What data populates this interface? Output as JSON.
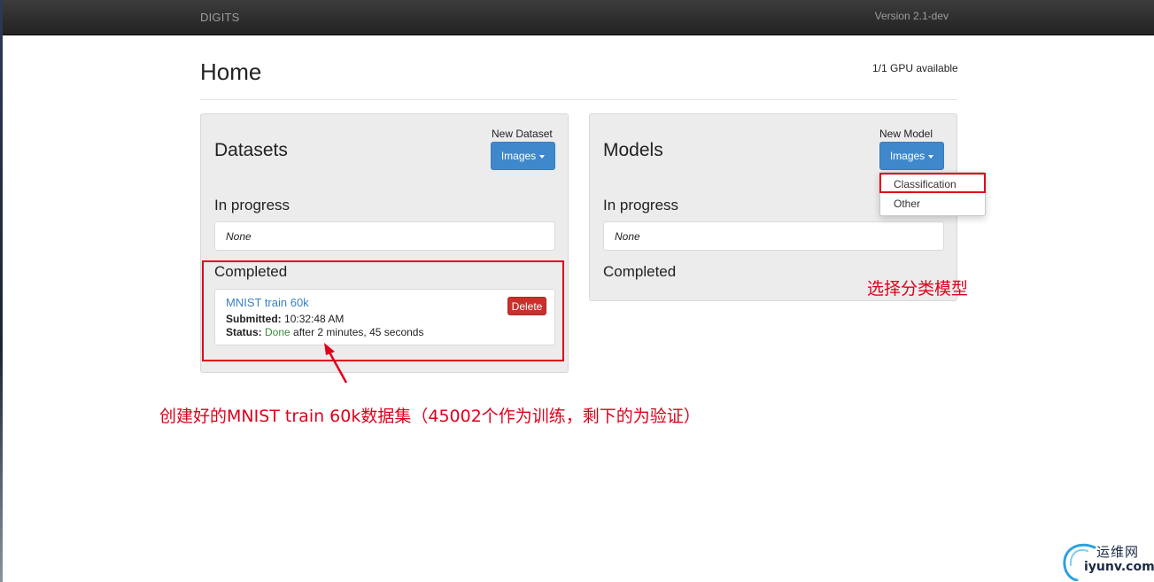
{
  "navbar": {
    "brand": "DIGITS",
    "version": "Version 2.1-dev"
  },
  "header": {
    "title": "Home",
    "gpu_status": "1/1 GPU available"
  },
  "datasets": {
    "title": "Datasets",
    "new_label": "New Dataset",
    "images_button": "Images",
    "in_progress_heading": "In progress",
    "in_progress_empty": "None",
    "completed_heading": "Completed",
    "jobs": [
      {
        "name": "MNIST train 60k",
        "submitted_label": "Submitted:",
        "submitted_value": "10:32:48 AM",
        "status_label": "Status:",
        "status_value": "Done",
        "status_detail": "after 2 minutes, 45 seconds",
        "delete_label": "Delete"
      }
    ]
  },
  "models": {
    "title": "Models",
    "new_label": "New Model",
    "images_button": "Images",
    "in_progress_heading": "In progress",
    "in_progress_empty": "None",
    "completed_heading": "Completed",
    "dropdown_options": [
      "Classification",
      "Other"
    ]
  },
  "annotations": {
    "dataset_note": "创建好的MNIST train 60k数据集（45002个作为训练，剩下的为验证）",
    "model_note": "选择分类模型"
  },
  "watermark": {
    "cn": "运维网",
    "en": "iyunv.com"
  },
  "colors": {
    "primary_button": "#3f88cc",
    "danger_button": "#c9302c",
    "annotation_red": "#e0001b",
    "status_done": "#3c8a3c",
    "link": "#3a7fc1"
  }
}
